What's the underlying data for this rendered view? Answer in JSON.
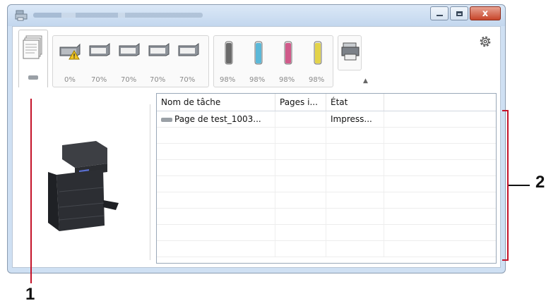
{
  "window": {
    "controls": {
      "minimize": "",
      "maximize": "",
      "close": "x"
    }
  },
  "toolbar": {
    "paper_trays": [
      {
        "level": "0%",
        "warning": true
      },
      {
        "level": "70%"
      },
      {
        "level": "70%"
      },
      {
        "level": "70%"
      },
      {
        "level": "70%"
      }
    ],
    "toners": [
      {
        "color": "#6b6b6b",
        "level": "98%"
      },
      {
        "color": "#5bb8d8",
        "level": "98%"
      },
      {
        "color": "#d05a8a",
        "level": "98%"
      },
      {
        "color": "#e3d34a",
        "level": "98%"
      }
    ],
    "eject_glyph": "▲"
  },
  "job_list": {
    "columns": [
      "Nom de tâche",
      "Pages i...",
      "État"
    ],
    "rows": [
      {
        "name": "Page de test_1003...",
        "pages": "",
        "state": "Impress..."
      }
    ]
  },
  "callouts": {
    "one": "1",
    "two": "2"
  },
  "colors": {
    "callout_line": "#c4132a"
  }
}
